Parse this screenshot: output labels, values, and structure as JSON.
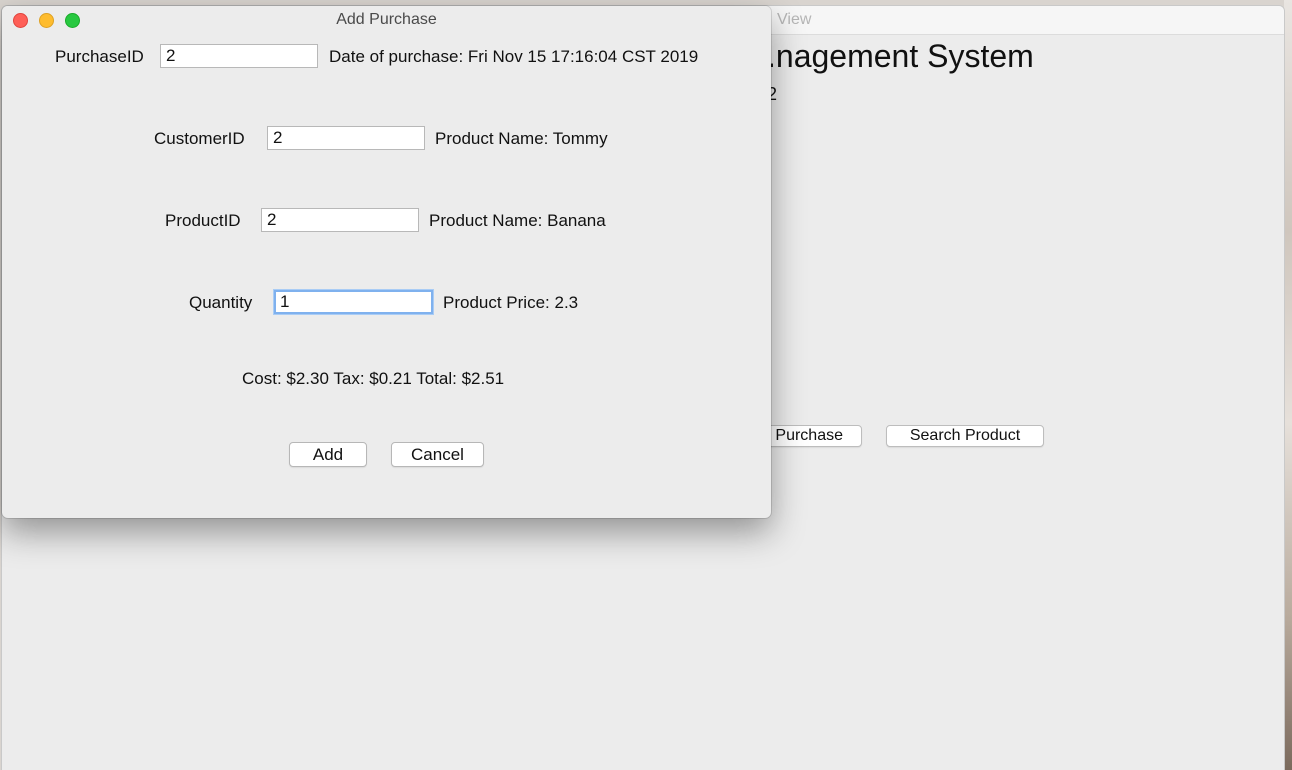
{
  "main_window": {
    "title": "View",
    "heading": ".nagement System",
    "subline": "2",
    "purchase_button": "Purchase",
    "search_product_button": "Search Product"
  },
  "dialog": {
    "title": "Add Purchase",
    "purchase_id": {
      "label": "PurchaseID",
      "value": "2"
    },
    "date_text": "Date of purchase: Fri Nov 15 17:16:04 CST 2019",
    "customer_id": {
      "label": "CustomerID",
      "value": "2"
    },
    "customer_name_text": "Product Name: Tommy",
    "product_id": {
      "label": "ProductID",
      "value": "2"
    },
    "product_name_text": "Product Name: Banana",
    "quantity": {
      "label": "Quantity",
      "value": "1"
    },
    "product_price_text": "Product Price: 2.3",
    "summary_text": "Cost: $2.30 Tax: $0.21 Total: $2.51",
    "add_button": "Add",
    "cancel_button": "Cancel"
  },
  "colors": {
    "close": "#fe5f57",
    "minimize": "#febc2e",
    "maximize": "#28c840",
    "focus_ring": "#7fb1ee"
  }
}
